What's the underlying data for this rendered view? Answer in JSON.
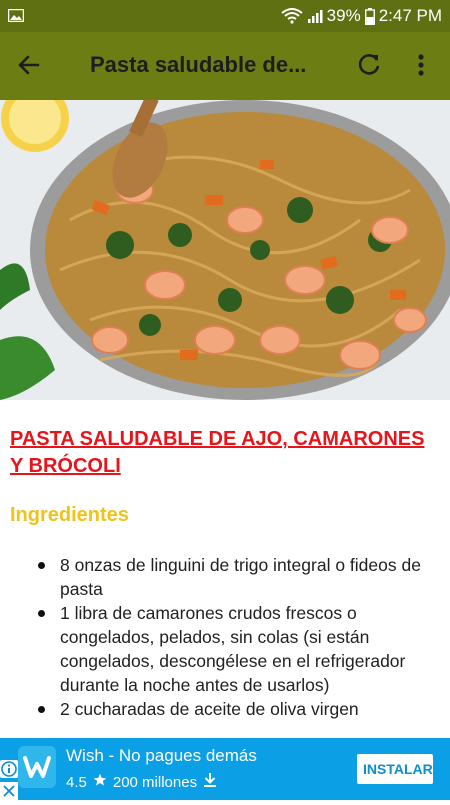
{
  "status_bar": {
    "battery": "39%",
    "time": "2:47 PM",
    "icons": [
      "gallery-icon",
      "wifi-icon",
      "signal-icon",
      "battery-icon"
    ]
  },
  "app_bar": {
    "title": "Pasta saludable de...",
    "icons": [
      "back-arrow-icon",
      "refresh-icon",
      "more-vert-icon"
    ],
    "background": "#6c7e13"
  },
  "recipe": {
    "title": "PASTA SALUDABLE DE AJO, CAMARONES Y BRÓCOLI",
    "title_color": "#e8141b",
    "ingredients_heading": "Ingredientes",
    "ingredients_heading_color": "#f0c31a",
    "ingredients": [
      "8 onzas de linguini de trigo integral o fideos de pasta",
      "1 libra de camarones crudos frescos o congelados, pelados, sin colas (si están congelados, descongélese en el refrigerador durante la noche antes de usarlos)",
      "2 cucharadas de aceite de oliva virgen"
    ]
  },
  "ad": {
    "app_name": "Wish - No pagues demás",
    "rating": "4.5",
    "downloads": "200 millones",
    "install_label": "INSTALAR",
    "background": "#0b9fe6",
    "icons": [
      "info-icon",
      "close-icon",
      "wish-logo-icon",
      "star-icon",
      "download-icon"
    ]
  }
}
